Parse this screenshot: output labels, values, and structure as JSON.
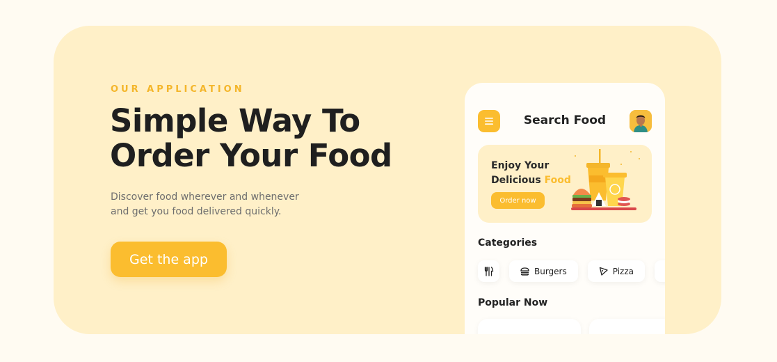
{
  "hero": {
    "eyebrow": "OUR APPLICATION",
    "headline_line1": "Simple Way To",
    "headline_line2": "Order Your Food",
    "subtext": "Discover food wherever and whenever and get you food delivered quickly.",
    "cta_label": "Get the app"
  },
  "app": {
    "title": "Search Food",
    "banner": {
      "line1": "Enjoy Your",
      "line2_prefix": "Delicious ",
      "line2_accent": "Food",
      "button_label": "Order now"
    },
    "categories_title": "Categories",
    "categories": [
      {
        "label": "Burgers",
        "icon": "burger-icon"
      },
      {
        "label": "Pizza",
        "icon": "pizza-icon"
      }
    ],
    "popular_title": "Popular Now"
  },
  "colors": {
    "accent": "#fbbd2f",
    "hero_bg": "#fff0c8",
    "page_bg": "#fffbf2"
  }
}
